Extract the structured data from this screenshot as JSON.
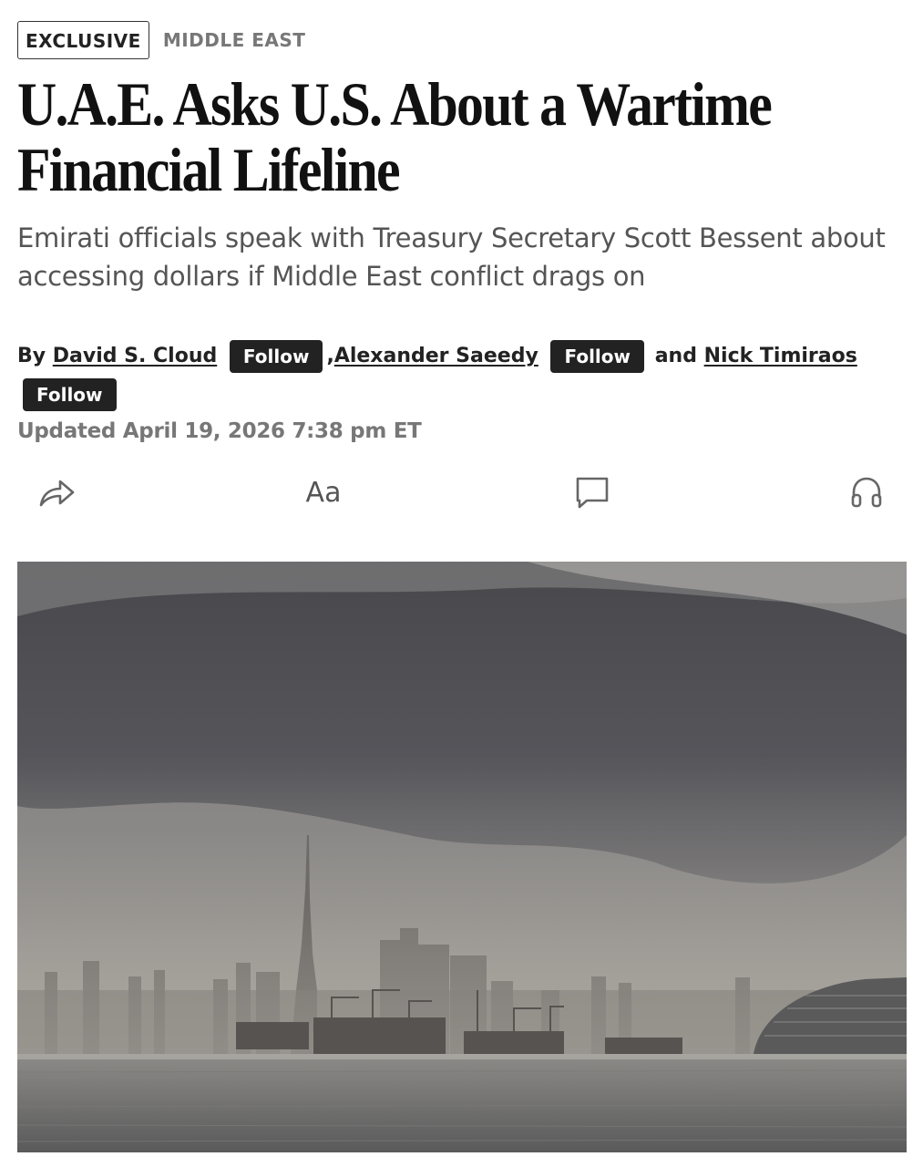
{
  "article": {
    "tag_exclusive": "EXCLUSIVE",
    "tag_section": "MIDDLE EAST",
    "headline": "U.A.E. Asks U.S. About a Wartime Financial Lifeline",
    "dek": "Emirati officials speak with Treasury Secretary Scott Bessent about accessing dollars if Middle East conflict drags on",
    "byline": {
      "prefix": "By",
      "authors": [
        "David S. Cloud",
        "Alexander Saeedy",
        "Nick Timiraos"
      ],
      "separator": ",",
      "conjunction": "and",
      "follow_label": "Follow"
    },
    "timestamp": "Updated April 19, 2026 7:38 pm ET"
  },
  "toolbar": {
    "share_icon": "share-arrow-icon",
    "text_size_label": "Aa",
    "comment_icon": "comment-icon",
    "listen_icon": "headphones-icon"
  },
  "colors": {
    "text_primary": "#111111",
    "text_secondary": "#555555",
    "text_muted": "#777777",
    "button_bg": "#222222",
    "button_text": "#ffffff"
  }
}
